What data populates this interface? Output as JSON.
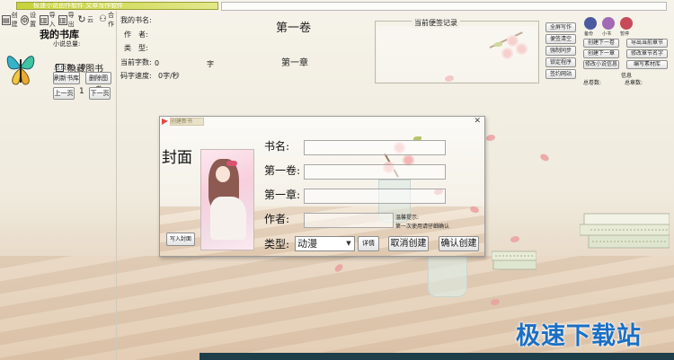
{
  "app": {
    "title_strip": "极速小说创作软件 文章写作软件"
  },
  "toolbar": {
    "items": [
      {
        "icon": "document-icon",
        "label": "创建"
      },
      {
        "icon": "gear-icon",
        "label": "设置"
      },
      {
        "icon": "book-icon",
        "label": "导入"
      },
      {
        "icon": "book-icon",
        "label": "导出"
      },
      {
        "icon": "refresh-icon",
        "label": "云"
      },
      {
        "icon": "person-icon",
        "label": "合作"
      }
    ]
  },
  "library": {
    "title": "我的书库",
    "novel_total_label": "小说总量:",
    "total_pages_label": "总页数:",
    "total_pages_value": "0",
    "hide_books_label": "隐藏图书",
    "refresh_button": "刷新书库",
    "delete_button": "删除图书",
    "prev_button": "上一页",
    "next_button": "下一页",
    "page_number": "1"
  },
  "info": {
    "my_book_label": "我的书名:",
    "author_label": "作　者:",
    "type_label": "类　型:",
    "current_words_label": "当前字数:",
    "current_words_value": "0",
    "word_unit": "字",
    "typing_speed_label": "码字速度:",
    "typing_speed_value": "0字/秒",
    "volume_title": "第一卷",
    "chapter_title": "第一章"
  },
  "notes": {
    "label": "当前便签记录",
    "buttons": [
      "全屏写作",
      "便签清空",
      "强制同步",
      "锁定程序",
      "签约网站"
    ]
  },
  "right_panel": {
    "avatars": [
      {
        "label": "备份",
        "color": "#4b5a9e"
      },
      {
        "label": "小书",
        "color": "#a06ab4"
      },
      {
        "label": "暂停",
        "color": "#c84a5a"
      }
    ],
    "buttons": [
      "创建下一卷",
      "导出当前章节",
      "创建下一章",
      "修改章节名字",
      "修改小说信息",
      "编写素材库"
    ],
    "info_label": "信息",
    "total_volumes_label": "总卷数:",
    "total_chapters_label": "总章数:"
  },
  "dialog": {
    "title": "创建新书",
    "cover_label": "封面",
    "write_cover_button": "写入封面",
    "fields": [
      {
        "label": "书名:",
        "value": ""
      },
      {
        "label": "第一卷:",
        "value": ""
      },
      {
        "label": "第一章:",
        "value": ""
      },
      {
        "label": "作者:",
        "value": ""
      }
    ],
    "type_label": "类型:",
    "type_value": "动漫",
    "detail_button": "详情",
    "cancel_button": "取消创建",
    "confirm_button": "确认创建",
    "tip_title": "温馨提示:",
    "tip_text": "第一次使用请仔细确认",
    "close_symbol": "✕"
  },
  "watermark": {
    "text": "极速下载站"
  },
  "colors": {
    "accent": "#c7d23a",
    "watermark": "#1a6fc4",
    "bottom_bar": "#1e3f49"
  }
}
